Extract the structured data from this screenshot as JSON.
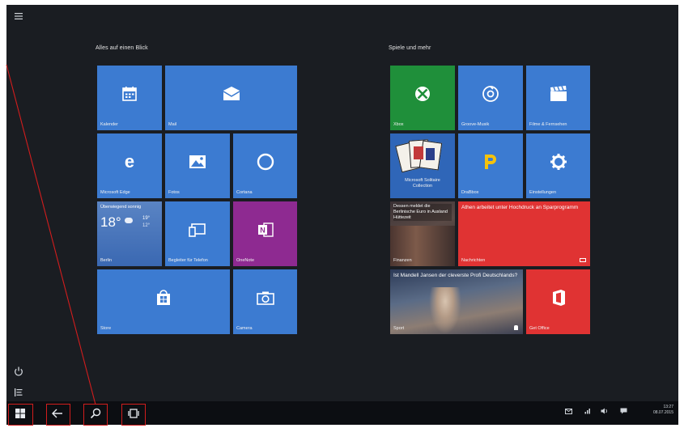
{
  "groups": {
    "left_title": "Alles auf einen Blick",
    "right_title": "Spiele und mehr"
  },
  "tiles": {
    "kalender": "Kalender",
    "mail": "Mail",
    "edge": "Microsoft Edge",
    "fotos": "Fotos",
    "cortana": "Cortana",
    "weather_condition": "Überwiegend sonnig",
    "weather_temp": "18°",
    "weather_hi": "19°",
    "weather_lo": "12°",
    "weather_city": "Berlin",
    "phone": "Begleiter für Telefon",
    "onenote": "OneNote",
    "store": "Store",
    "camera": "Camera",
    "xbox": "Xbox",
    "groove": "Groove-Musik",
    "films": "Filme & Fernsehen",
    "solitaire": "Microsoft Solitaire Collection",
    "drawboard": "DraBbox",
    "settings": "Einstellungen",
    "finance_text": "Dessen meldet die Berlinische Euro in Ausland Hüttezeit",
    "finance_label": "Finanzen",
    "news_text": "Athen arbeitet unter Hochdruck an Sparprogramm",
    "news_label": "Nachrichten",
    "sport_text": "Ist Mandell Jansen der cleverste Profi Deutschlands?",
    "sport_label": "Sport",
    "office_label": "Get Office"
  },
  "taskbar": {
    "clock_time": "13:27",
    "clock_date": "08.07.2015"
  },
  "colors": {
    "tile_blue": "#3c7bd1",
    "tile_green": "#1f8f3a",
    "tile_red": "#e03333",
    "tile_purple": "#8e2a91",
    "highlight_red": "#d21d1d"
  },
  "icons": {
    "hamburger": "hamburger-icon",
    "power": "power-icon",
    "all_apps": "all-apps-icon",
    "start": "windows-start-icon",
    "back": "back-arrow-icon",
    "search": "search-icon",
    "task_view": "task-view-icon"
  }
}
